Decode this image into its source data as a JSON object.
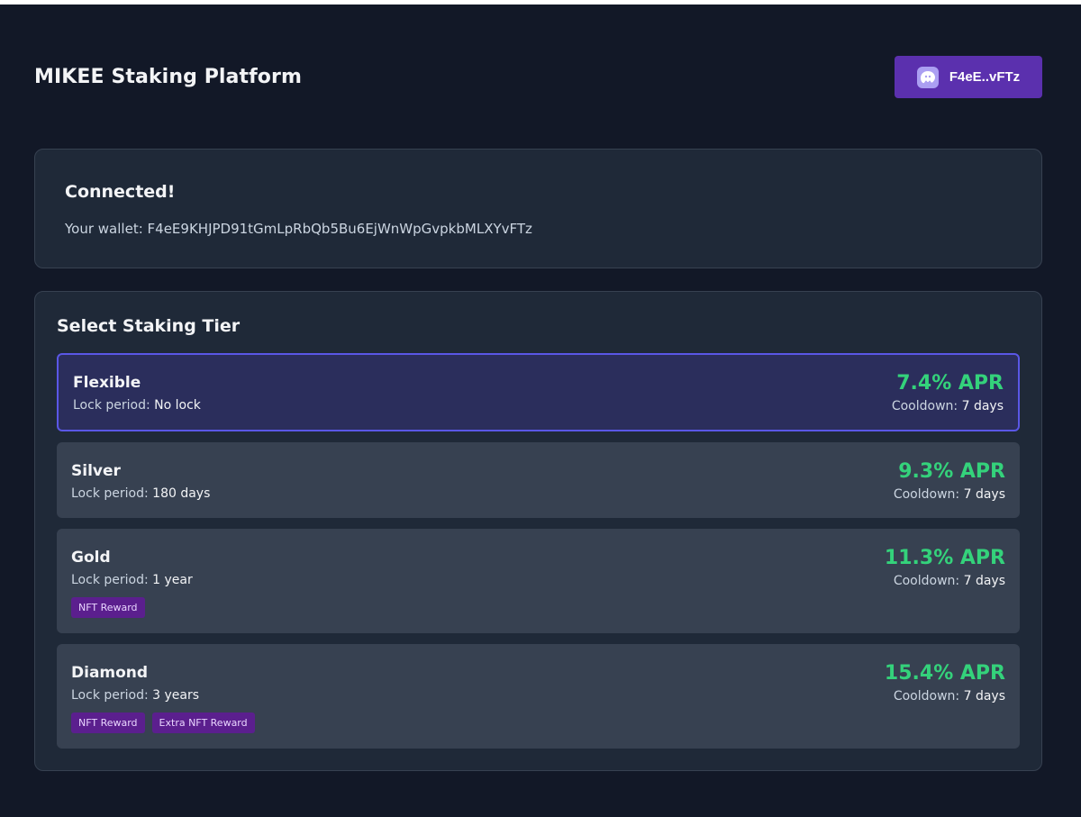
{
  "header": {
    "title": "MIKEE Staking Platform",
    "wallet_button_label": "F4eE..vFTz",
    "wallet_icon": "phantom-ghost-icon"
  },
  "connection": {
    "title": "Connected!",
    "wallet_prefix": "Your wallet:",
    "wallet_address": "F4eE9KHJPD91tGmLpRbQb5Bu6EjWnWpGvpkbMLXYvFTz"
  },
  "tiers_section": {
    "title": "Select Staking Tier",
    "lock_label": "Lock period:",
    "cooldown_label": "Cooldown:",
    "tiers": [
      {
        "name": "Flexible",
        "lock": "No lock",
        "apr": "7.4% APR",
        "cooldown": "7 days",
        "selected": true,
        "badges": []
      },
      {
        "name": "Silver",
        "lock": "180 days",
        "apr": "9.3% APR",
        "cooldown": "7 days",
        "selected": false,
        "badges": []
      },
      {
        "name": "Gold",
        "lock": "1 year",
        "apr": "11.3% APR",
        "cooldown": "7 days",
        "selected": false,
        "badges": [
          "NFT Reward"
        ]
      },
      {
        "name": "Diamond",
        "lock": "3 years",
        "apr": "15.4% APR",
        "cooldown": "7 days",
        "selected": false,
        "badges": [
          "NFT Reward",
          "Extra NFT Reward"
        ]
      }
    ]
  },
  "colors": {
    "background": "#121827",
    "card": "#1f2938",
    "tier": "#374151",
    "selected_tier": "#2b2e5c",
    "selected_border": "#5a57e6",
    "accent_purple": "#5b30ae",
    "apr_green": "#34d27b",
    "badge": "#5b1f8e"
  }
}
